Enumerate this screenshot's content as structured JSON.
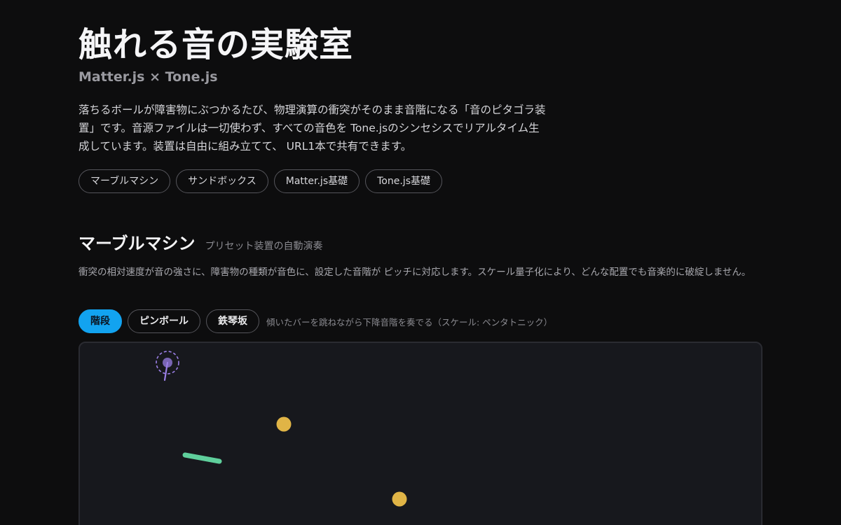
{
  "hero": {
    "title": "触れる音の実験室",
    "subtitle": "Matter.js × Tone.js",
    "intro": "落ちるボールが障害物にぶつかるたび、物理演算の衝突がそのまま音階になる「音のピタゴラ装置」です。音源ファイルは一切使わず、すべての音色を Tone.jsのシンセシスでリアルタイム生成しています。装置は自由に組み立てて、 URL1本で共有できます。"
  },
  "tags": [
    {
      "label": "マーブルマシン"
    },
    {
      "label": "サンドボックス"
    },
    {
      "label": "Matter.js基礎"
    },
    {
      "label": "Tone.js基礎"
    }
  ],
  "section": {
    "title": "マーブルマシン",
    "subtitle": "プリセット装置の自動演奏",
    "description": "衝突の相対速度が音の強さに、障害物の種類が音色に、設定した音階が ピッチに対応します。スケール量子化により、どんな配置でも音楽的に破綻しません。"
  },
  "presets": {
    "items": [
      {
        "label": "階段",
        "active": true
      },
      {
        "label": "ピンボール",
        "active": false
      },
      {
        "label": "鉄琴坂",
        "active": false
      }
    ],
    "description": "傾いたバーを跳ねながら下降音階を奏でる（スケール: ペンタトニック）"
  },
  "colors": {
    "accent": "#12a3f0",
    "background": "#0d0d0e",
    "stage": "#17181d",
    "spawner": "#9b7fe6",
    "ball": "#e0b446",
    "bar": "#5fcf9c"
  },
  "icons": {
    "spawner": "dashed-circle-emitter-icon"
  }
}
